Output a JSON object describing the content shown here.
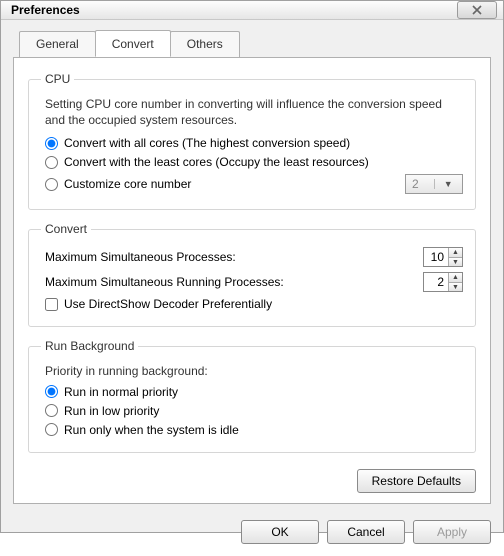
{
  "window": {
    "title": "Preferences"
  },
  "tabs": {
    "general": "General",
    "convert": "Convert",
    "others": "Others",
    "active": "convert"
  },
  "cpu": {
    "legend": "CPU",
    "desc": "Setting CPU core number in converting will influence the conversion speed and the occupied system resources.",
    "opt_all": "Convert with all cores (The highest conversion speed)",
    "opt_least": "Convert with the least cores (Occupy the least resources)",
    "opt_custom": "Customize core number",
    "selected": "all",
    "custom_value": "2"
  },
  "convert": {
    "legend": "Convert",
    "max_proc_label": "Maximum Simultaneous Processes:",
    "max_proc_value": "10",
    "max_run_label": "Maximum Simultaneous Running Processes:",
    "max_run_value": "2",
    "directshow_label": "Use DirectShow Decoder Preferentially",
    "directshow_checked": false
  },
  "bg": {
    "legend": "Run Background",
    "heading": "Priority in running background:",
    "opt_normal": "Run in normal priority",
    "opt_low": "Run in low priority",
    "opt_idle": "Run only when the system is idle",
    "selected": "normal"
  },
  "buttons": {
    "restore": "Restore Defaults",
    "ok": "OK",
    "cancel": "Cancel",
    "apply": "Apply"
  }
}
